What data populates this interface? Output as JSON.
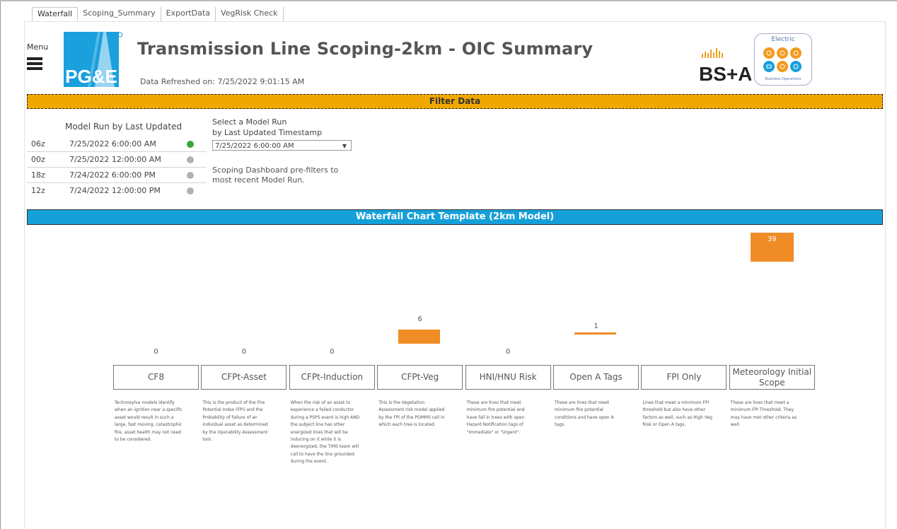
{
  "tabs": [
    {
      "label": "Waterfall"
    },
    {
      "label": "Scoping_Summary"
    },
    {
      "label": "ExportData"
    },
    {
      "label": "VegRisk Check"
    }
  ],
  "header": {
    "menu_label": "Menu",
    "logo_text": "PG&E",
    "title": "Transmission Line Scoping-2km - OIC Summary",
    "refreshed": "Data Refreshed on: 7/25/2022 9:01:15 AM",
    "bsa_text": "BS+A",
    "electric_label": "Electric",
    "electric_sub": "Business Operations"
  },
  "filter_bar": "Filter Data",
  "model_runs": {
    "heading": "Model Run by Last Updated",
    "rows": [
      {
        "code": "06z",
        "time": "7/25/2022 6:00:00 AM",
        "status_color": "#3aa63a"
      },
      {
        "code": "00z",
        "time": "7/25/2022 12:00:00 AM",
        "status_color": "#b7b0ad"
      },
      {
        "code": "18z",
        "time": "7/24/2022 6:00:00 PM",
        "status_color": "#b7b0ad"
      },
      {
        "code": "12z",
        "time": "7/24/2022 12:00:00 PM",
        "status_color": "#b7b0ad"
      }
    ]
  },
  "selector": {
    "title_line1": "Select a Model Run",
    "title_line2": "by Last Updated Timestamp",
    "value": "7/25/2022 6:00:00 AM",
    "note_line1": "Scoping Dashboard pre-filters to",
    "note_line2": "most recent Model Run."
  },
  "waterfall_bar": "Waterfall Chart Template (2km Model)",
  "chart_data": {
    "type": "bar",
    "title": "Waterfall Chart Template (2km Model)",
    "categories": [
      "CF8",
      "CFPt-Asset",
      "CFPt-Induction",
      "CFPt-Veg",
      "HNI/HNU Risk",
      "Open A Tags",
      "FPI Only",
      "Meteorology Initial Scope"
    ],
    "values": [
      0,
      0,
      0,
      6,
      0,
      1,
      null,
      39
    ],
    "bar_color": "#f08c26",
    "descriptions": [
      [
        "Technosylva models identify",
        "when an ignition near a specific",
        "asset would result in such a",
        "large, fast moving, catastrophic",
        "fire, asset health may not need",
        "to be considered."
      ],
      [
        "This is the product of the Fire",
        "Potential Index (FPI) and the",
        "Probability of failure of an",
        "individual asset as determined",
        "by the Operability Assessment",
        "tool."
      ],
      [
        "When the risk of an asset to",
        "experience a failed conductor",
        "during a PSPS event is high AND",
        "the subject line has other",
        "energized lines that will be",
        "inducing on it while it is",
        "deenergized, the TIMS team will",
        "call to have the line grounded",
        "during the event."
      ],
      [
        "This is the Vegetation",
        "Assessment risk model applied",
        "by the FPI of the POMMS cell in",
        "which each tree is located."
      ],
      [
        "These are lines that meet",
        "minimum fire potential and",
        "have fall in trees with open",
        "Hazard Notification tags of",
        "\"Immediate\" or \"Urgent\"."
      ],
      [
        "These are lines that meet",
        "minimum fire potential",
        "conditions and have open A",
        "tags."
      ],
      [
        "Lines that meet a minimum FPI",
        "threshold but also have other",
        "factors as well, such as High Veg",
        "Risk or Open A tags."
      ],
      [
        "These are lines that meet a",
        "minimum FPI Threshold. They",
        "may have met other criteria as",
        "well."
      ]
    ]
  }
}
